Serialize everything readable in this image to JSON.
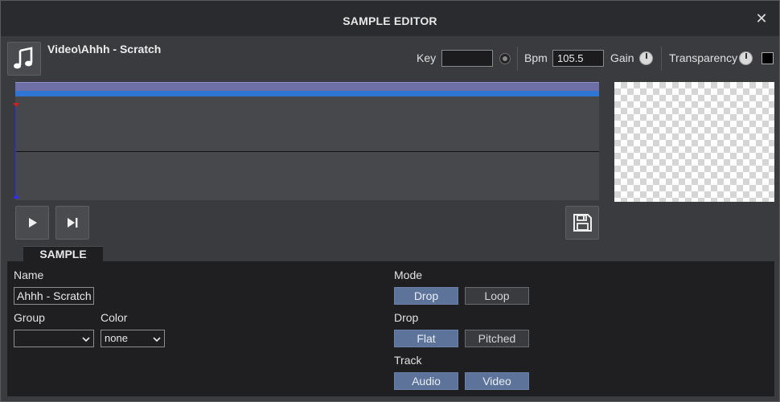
{
  "window": {
    "title": "SAMPLE EDITOR",
    "close_glyph": "✕"
  },
  "header": {
    "sample_name": "Video\\Ahhh - Scratch",
    "icon": "music-note-icon",
    "key_label": "Key",
    "key_value": "",
    "bpm_label": "Bpm",
    "bpm_value": "105.5",
    "gain_label": "Gain",
    "transparency_label": "Transparency"
  },
  "transport": {
    "play_icon": "play-icon",
    "skip_icon": "skip-to-end-icon",
    "save_icon": "save-icon"
  },
  "tabs": [
    {
      "label": "SAMPLE",
      "active": true
    }
  ],
  "sample_panel": {
    "name_label": "Name",
    "name_value": "Ahhh - Scratch",
    "group_label": "Group",
    "group_value": "",
    "color_label": "Color",
    "color_value": "none",
    "mode_label": "Mode",
    "mode_options": [
      {
        "label": "Drop",
        "active": true
      },
      {
        "label": "Loop",
        "active": false
      }
    ],
    "drop_label": "Drop",
    "drop_options": [
      {
        "label": "Flat",
        "active": true
      },
      {
        "label": "Pitched",
        "active": false
      }
    ],
    "track_label": "Track",
    "track_options": [
      {
        "label": "Audio",
        "active": true
      },
      {
        "label": "Video",
        "active": true
      }
    ]
  },
  "colors": {
    "accent_active": "#5d7399",
    "waveform_band": "#6f6fa8",
    "waveform_band2": "#2e75d4",
    "cursor": "#2d2dff",
    "cursor_marker": "#d02020"
  }
}
